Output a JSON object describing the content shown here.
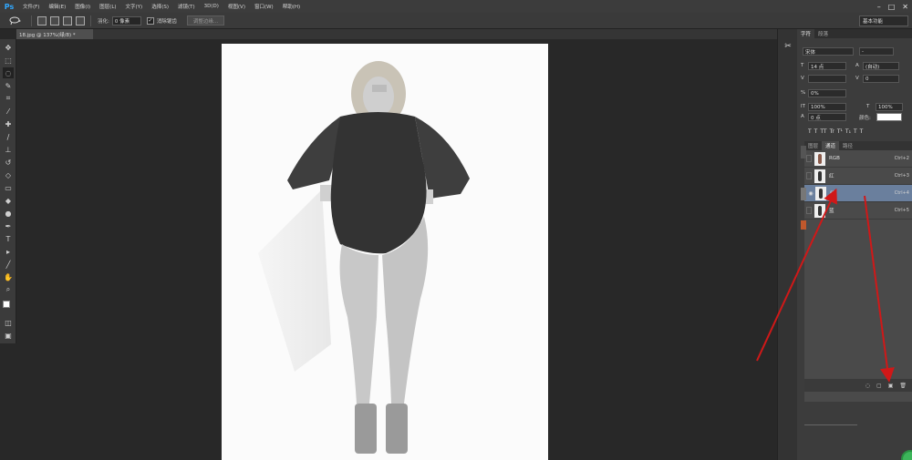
{
  "app": {
    "logo": "Ps",
    "menu": [
      "文件(F)",
      "编辑(E)",
      "图像(I)",
      "图层(L)",
      "文字(Y)",
      "选择(S)",
      "滤镜(T)",
      "3D(D)",
      "视图(V)",
      "窗口(W)",
      "帮助(H)"
    ],
    "window_controls": [
      "–",
      "□",
      "✕"
    ]
  },
  "options": {
    "feather_label": "羽化:",
    "feather_value": "0 像素",
    "antialias_label": "消除锯齿",
    "refine_edge": "调整边缘...",
    "workspace": "基本功能"
  },
  "document": {
    "tab_title": "18.jpg @ 137%(绿/8) *"
  },
  "character_panel": {
    "tabs": [
      "字符",
      "段落"
    ],
    "font_family": "宋体",
    "font_style": "-",
    "font_size": "14 点",
    "leading": "(自动)",
    "kerning": "0",
    "tracking": "0%",
    "vertical_scale": "100%",
    "horizontal_scale": "100%",
    "baseline_shift": "0 点",
    "color_label": "颜色:",
    "type_buttons": [
      "T",
      "T",
      "TT",
      "Tr",
      "T¹",
      "T₁",
      "T",
      "T"
    ]
  },
  "channels_panel": {
    "tabs": [
      "图层",
      "通道",
      "路径"
    ],
    "active_tab": "通道",
    "channels": [
      {
        "name": "RGB",
        "shortcut": "Ctrl+2",
        "visible": false,
        "selected": false
      },
      {
        "name": "红",
        "shortcut": "Ctrl+3",
        "visible": false,
        "selected": false
      },
      {
        "name": "绿",
        "shortcut": "Ctrl+4",
        "visible": true,
        "selected": true
      },
      {
        "name": "蓝",
        "shortcut": "Ctrl+5",
        "visible": false,
        "selected": false
      }
    ]
  },
  "colors": {
    "accent": "#31a8ff",
    "selected_row": "#6a7f9d",
    "annotation_arrow": "#d01818"
  }
}
